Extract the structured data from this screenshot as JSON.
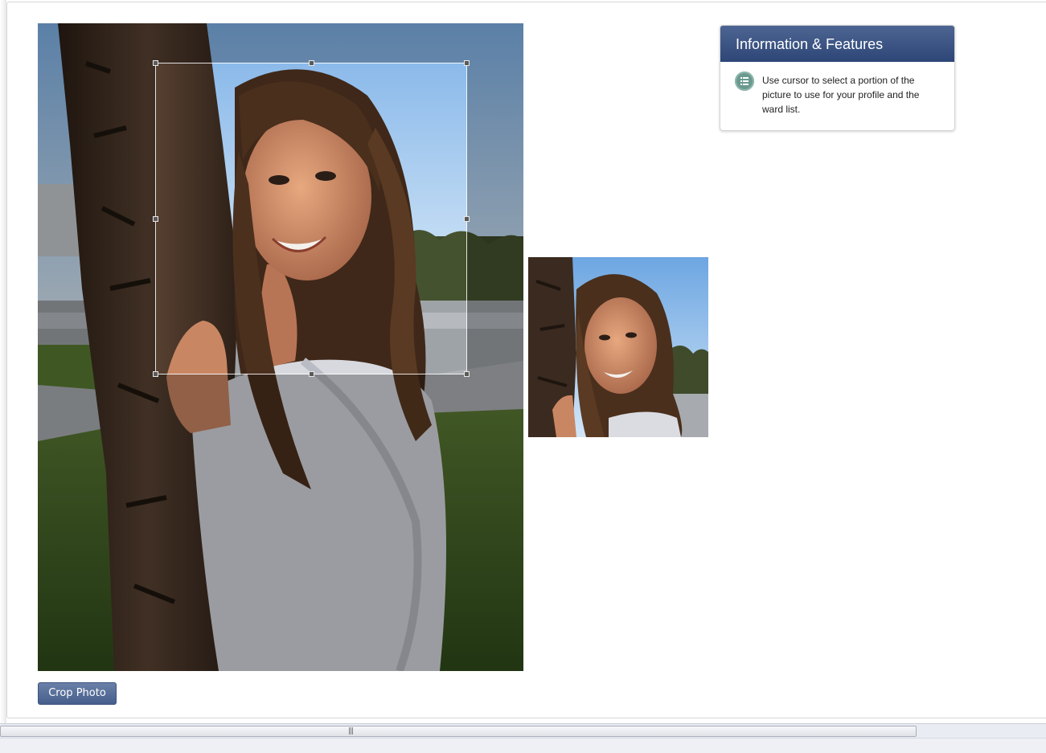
{
  "info_panel": {
    "title": "Information & Features",
    "icon": "list-icon",
    "text": "Use cursor to select a portion of the picture to use for your profile and the ward list."
  },
  "crop_button": {
    "label": "Crop Photo"
  },
  "colors": {
    "header_top": "#4d6592",
    "header_bottom": "#2e4677",
    "button": "#465e8b",
    "sky": "#8fbbe6",
    "grass": "#4e6b2c",
    "bark": "#3d2c21",
    "shirt": "#dcdde2",
    "hair": "#4a2f1c"
  }
}
